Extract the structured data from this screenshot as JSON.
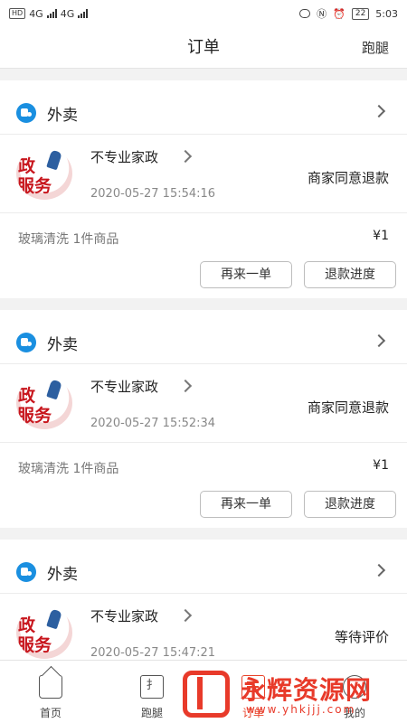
{
  "statusbar": {
    "left_badges": [
      "HD",
      "4G",
      "4G"
    ],
    "battery": "22",
    "time": "5:03"
  },
  "header": {
    "title": "订单",
    "right_link": "跑腿"
  },
  "orders": [
    {
      "type_label": "外卖",
      "shop_name": "不专业家政",
      "thumb_text_1": "政",
      "thumb_text_2": "服务",
      "status": "商家同意退款",
      "time": "2020-05-27 15:54:16",
      "summary": "玻璃清洗 1件商品",
      "price": "¥1",
      "buttons": [
        "再来一单",
        "退款进度"
      ]
    },
    {
      "type_label": "外卖",
      "shop_name": "不专业家政",
      "thumb_text_1": "政",
      "thumb_text_2": "服务",
      "status": "商家同意退款",
      "time": "2020-05-27 15:52:34",
      "summary": "玻璃清洗 1件商品",
      "price": "¥1",
      "buttons": [
        "再来一单",
        "退款进度"
      ]
    },
    {
      "type_label": "外卖",
      "shop_name": "不专业家政",
      "thumb_text_1": "政",
      "thumb_text_2": "服务",
      "status": "等待评价",
      "time": "2020-05-27 15:47:21"
    }
  ],
  "tabs": [
    {
      "label": "首页",
      "icon": "home-icon"
    },
    {
      "label": "跑腿",
      "icon": "run-errand-icon"
    },
    {
      "label": "订单",
      "icon": "order-icon"
    },
    {
      "label": "我的",
      "icon": "profile-icon"
    }
  ],
  "watermark": {
    "text": "永辉资源网",
    "url": "www.yhkjjj.com"
  },
  "colors": {
    "accent": "#e8452c",
    "type_badge": "#1a8fe0"
  }
}
